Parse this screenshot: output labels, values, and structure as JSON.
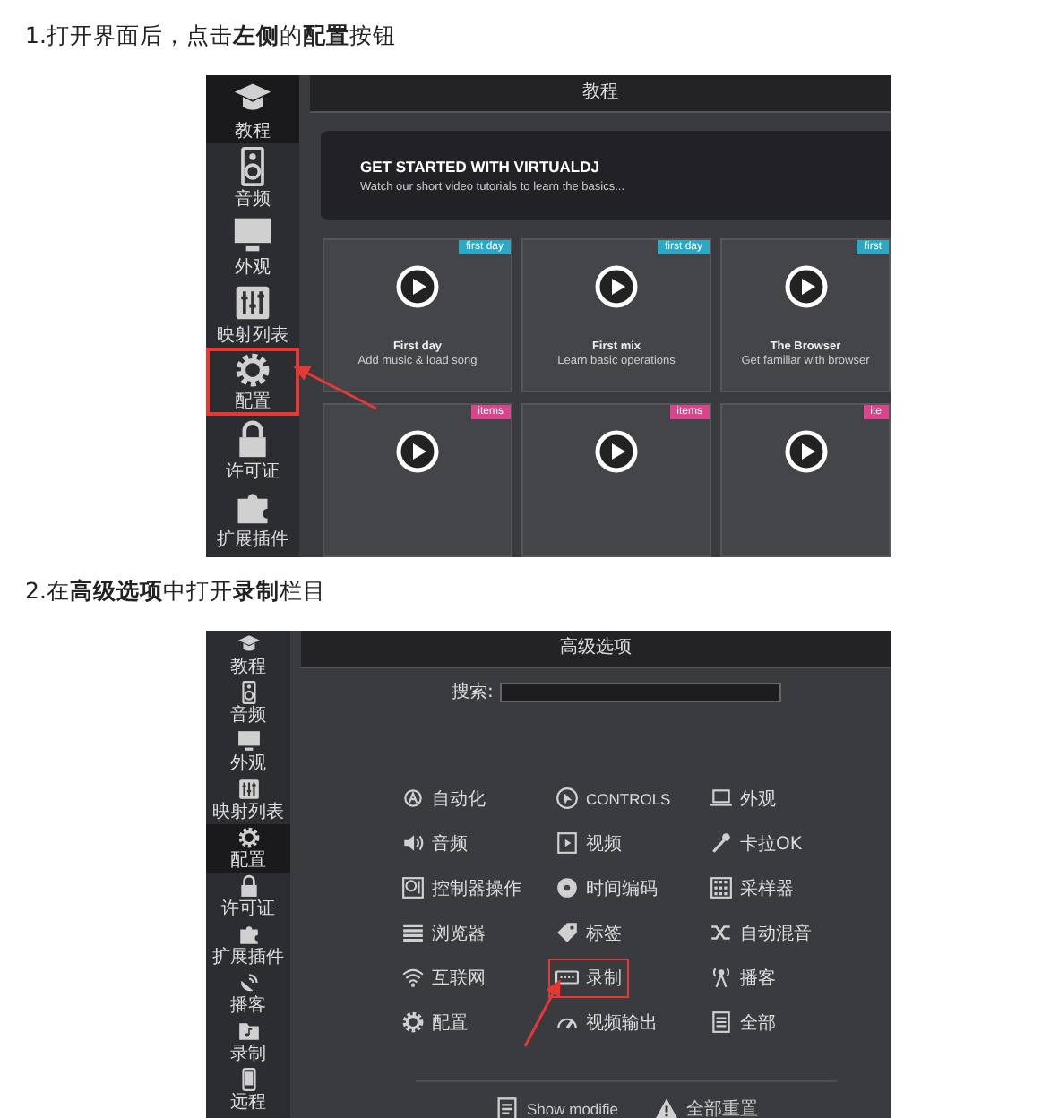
{
  "step1": {
    "instruction": "1.打开界面后，点击**左侧**的**配置**按钮",
    "app": {
      "sidebar": [
        {
          "label": "教程",
          "selected": true,
          "highlighted": false
        },
        {
          "label": "音频",
          "selected": false,
          "highlighted": false
        },
        {
          "label": "外观",
          "selected": false,
          "highlighted": false
        },
        {
          "label": "映射列表",
          "selected": false,
          "highlighted": false
        },
        {
          "label": "配置",
          "selected": false,
          "highlighted": true
        },
        {
          "label": "许可证",
          "selected": false,
          "highlighted": false
        },
        {
          "label": "扩展插件",
          "selected": false,
          "highlighted": false
        }
      ],
      "header_title": "教程",
      "banner": {
        "title": "GET STARTED WITH VIRTUALDJ",
        "subtitle": "Watch our short video tutorials to learn the basics..."
      },
      "tiles": [
        {
          "tag": "first day",
          "color": "#2aa8c4",
          "title": "First day",
          "subtitle": "Add music & load song"
        },
        {
          "tag": "first day",
          "color": "#2aa8c4",
          "title": "First mix",
          "subtitle": "Learn basic operations"
        },
        {
          "tag": "first",
          "color": "#2aa8c4",
          "title": "The Browser",
          "subtitle": "Get familiar with browser"
        },
        {
          "tag": "items",
          "color": "#d9448a"
        },
        {
          "tag": "items",
          "color": "#d9448a"
        },
        {
          "tag": "ite",
          "color": "#d9448a"
        }
      ]
    }
  },
  "step2": {
    "instruction": "2.在**高级选项**中打开**录制**栏目",
    "app": {
      "sidebar": [
        {
          "label": "教程",
          "selected": false
        },
        {
          "label": "音频",
          "selected": false
        },
        {
          "label": "外观",
          "selected": false
        },
        {
          "label": "映射列表",
          "selected": false
        },
        {
          "label": "配置",
          "selected": true
        },
        {
          "label": "许可证",
          "selected": false
        },
        {
          "label": "扩展插件",
          "selected": false
        },
        {
          "label": "播客",
          "selected": false
        },
        {
          "label": "录制",
          "selected": false
        },
        {
          "label": "远程",
          "selected": false
        }
      ],
      "header_title": "高级选项",
      "search": {
        "label": "搜索:"
      },
      "options": [
        {
          "label": "自动化",
          "highlighted": false
        },
        {
          "label": "CONTROLS",
          "highlighted": false
        },
        {
          "label": "外观",
          "highlighted": false
        },
        {
          "label": "音频",
          "highlighted": false
        },
        {
          "label": "视频",
          "highlighted": false
        },
        {
          "label": "卡拉OK",
          "highlighted": false
        },
        {
          "label": "控制器操作",
          "highlighted": false
        },
        {
          "label": "时间编码",
          "highlighted": false
        },
        {
          "label": "采样器",
          "highlighted": false
        },
        {
          "label": "浏览器",
          "highlighted": false
        },
        {
          "label": "标签",
          "highlighted": false
        },
        {
          "label": "自动混音",
          "highlighted": false
        },
        {
          "label": "互联网",
          "highlighted": false
        },
        {
          "label": "录制",
          "highlighted": true
        },
        {
          "label": "播客",
          "highlighted": false
        },
        {
          "label": "配置",
          "highlighted": false
        },
        {
          "label": "视频输出",
          "highlighted": false
        },
        {
          "label": "全部",
          "highlighted": false
        }
      ],
      "footer_buttons": [
        "Show modifie",
        "全部重置"
      ]
    }
  }
}
